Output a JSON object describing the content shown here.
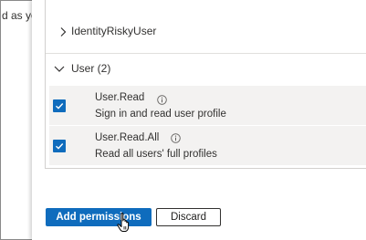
{
  "background_text": "d as you",
  "permissions": {
    "collapsed_group": "IdentityRiskyUser",
    "expanded_group": "User (2)",
    "items": [
      {
        "name": "User.Read",
        "description": "Sign in and read user profile",
        "checked": true,
        "info_icon": "info-icon"
      },
      {
        "name": "User.Read.All",
        "description": "Read all users' full profiles",
        "checked": true,
        "info_icon": "info-icon"
      }
    ]
  },
  "footer": {
    "add_label": "Add permissions",
    "discard_label": "Discard"
  },
  "colors": {
    "accent": "#0f6cbd",
    "row_bg": "#f3f2f1"
  }
}
